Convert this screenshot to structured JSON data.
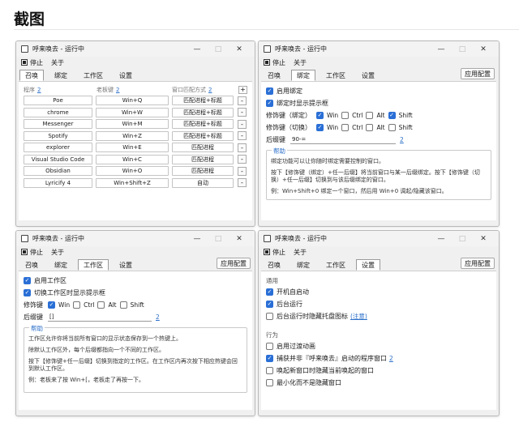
{
  "page": {
    "title": "截图"
  },
  "window": {
    "title": "呼来唤去 - 运行中",
    "menu": {
      "stop": "停止",
      "about": "关于"
    },
    "tabs": [
      "召唤",
      "绑定",
      "工作区",
      "设置"
    ],
    "apply": "应用配置",
    "min": "—",
    "max": "□",
    "close": "✕"
  },
  "summon": {
    "headers": {
      "program": "程序",
      "program_count": "2",
      "hotkey": "老板键",
      "hotkey_count": "2",
      "match": "窗口匹配方式",
      "match_count": "2"
    },
    "add": "+",
    "del": "-",
    "rows": [
      {
        "program": "Poe",
        "hotkey": "Win+Q",
        "match": "匹配进程+标题"
      },
      {
        "program": "chrome",
        "hotkey": "Win+W",
        "match": "匹配进程+标题"
      },
      {
        "program": "Messenger",
        "hotkey": "Win+M",
        "match": "匹配进程+标题"
      },
      {
        "program": "Spotify",
        "hotkey": "Win+Z",
        "match": "匹配进程+标题"
      },
      {
        "program": "explorer",
        "hotkey": "Win+E",
        "match": "匹配进程"
      },
      {
        "program": "Visual Studio Code",
        "hotkey": "Win+C",
        "match": "匹配进程"
      },
      {
        "program": "Obsidian",
        "hotkey": "Win+O",
        "match": "匹配进程"
      },
      {
        "program": "Lyricify 4",
        "hotkey": "Win+Shift+Z",
        "match": "自动"
      }
    ]
  },
  "bind": {
    "enable": "启用绑定",
    "show_tip": "绑定时显示提示框",
    "mod_bind_label": "修饰键（绑定）",
    "mod_switch_label": "修饰键（切换）",
    "mods_bind": [
      {
        "name": "Win",
        "checked": true
      },
      {
        "name": "Ctrl",
        "checked": false
      },
      {
        "name": "Alt",
        "checked": false
      },
      {
        "name": "Shift",
        "checked": true
      }
    ],
    "mods_switch": [
      {
        "name": "Win",
        "checked": true
      },
      {
        "name": "Ctrl",
        "checked": false
      },
      {
        "name": "Alt",
        "checked": false
      },
      {
        "name": "Shift",
        "checked": false
      }
    ],
    "suffix_label": "后缀键",
    "suffix_value": "90-=",
    "suffix_count": "2",
    "help_title": "帮助",
    "help_p1": "绑定功能可以让你随时绑定需要控制的窗口。",
    "help_p2": "按下【修饰键（绑定）+任一后缀】将当前窗口与某一后缀绑定。按下【修饰键（切换）+任一后缀】切换到与该后缀绑定的窗口。",
    "help_p3": "例：Win+Shift+0 绑定一个窗口，然后用 Win+0 调起/隐藏该窗口。"
  },
  "workspace": {
    "enable": "启用工作区",
    "show_tip": "切换工作区时显示提示框",
    "mod_label": "修饰键",
    "mods": [
      {
        "name": "Win",
        "checked": true
      },
      {
        "name": "Ctrl",
        "checked": false
      },
      {
        "name": "Alt",
        "checked": false
      },
      {
        "name": "Shift",
        "checked": false
      }
    ],
    "suffix_label": "后缀键",
    "suffix_value": "[]",
    "suffix_count": "2",
    "help_title": "帮助",
    "help_p1": "工作区允许你将当前所有窗口的显示状态保存到一个热键上。",
    "help_p2": "除默认工作区外，每个后缀都指向一个不同的工作区。",
    "help_p3": "按下【修饰键+任一后缀】切换到指定的工作区。在工作区内再次按下相应热键会回到默认工作区。",
    "help_p4": "例：老板来了按 Win+[，老板走了再按一下。"
  },
  "settings": {
    "general": "通用",
    "autostart": {
      "label": "开机自启动",
      "checked": true
    },
    "background": {
      "label": "后台运行",
      "checked": true
    },
    "hide_tray": {
      "label": "后台运行时隐藏托盘图标",
      "note": "(注意)",
      "checked": false
    },
    "behavior": "行为",
    "transition": {
      "label": "启用过渡动画",
      "checked": false
    },
    "capture_own": {
      "label": "捕获并非『呼来唤去』启动的程序窗口",
      "count": "2",
      "checked": true
    },
    "hide_on_new": {
      "label": "唤起新窗口时隐藏当前唤起的窗口",
      "checked": false
    },
    "min_no_hide": {
      "label": "最小化而不是隐藏窗口",
      "checked": false
    }
  }
}
